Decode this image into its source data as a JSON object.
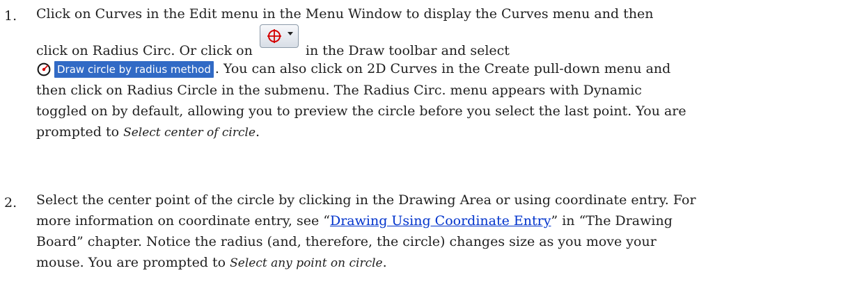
{
  "steps": [
    {
      "number": "1.",
      "line1": "Click on Curves in the Edit menu in the Menu Window to display the Curves menu and then",
      "line2_a": "click on Radius Circ. Or click on",
      "line2_b": "in the Draw toolbar and select",
      "menu_item_label": "Draw circle by radius method",
      "line3_after": ". You can also click on 2D Curves in the Create pull-down menu and",
      "line4": "then click on Radius Circle in the submenu. The Radius Circ. menu appears with Dynamic",
      "line5": "toggled on by default, allowing you to preview the circle before you select the last point. You are",
      "line6_before": "prompted to ",
      "prompt": "Select center of circle",
      "line6_after": "."
    },
    {
      "number": "2.",
      "line1": "Select the center point of the circle by clicking in the Drawing Area or using coordinate entry. For",
      "line2_before": "more information on coordinate entry, see “",
      "link_text": "Drawing Using Coordinate Entry",
      "line2_after": "” in “The Drawing",
      "line3": "Board” chapter. Notice the radius (and, therefore, the circle) changes size as you move your",
      "line4_before": "mouse. You are prompted to ",
      "prompt": "Select any point on circle",
      "line4_after": "."
    }
  ],
  "icons": {
    "toolbar_button": "circle-crosshair-dropdown-icon",
    "menu_icon": "circle-radius-icon",
    "accent_color": "#316ac5",
    "icon_red": "#d40000",
    "link_color": "#0033cc"
  }
}
